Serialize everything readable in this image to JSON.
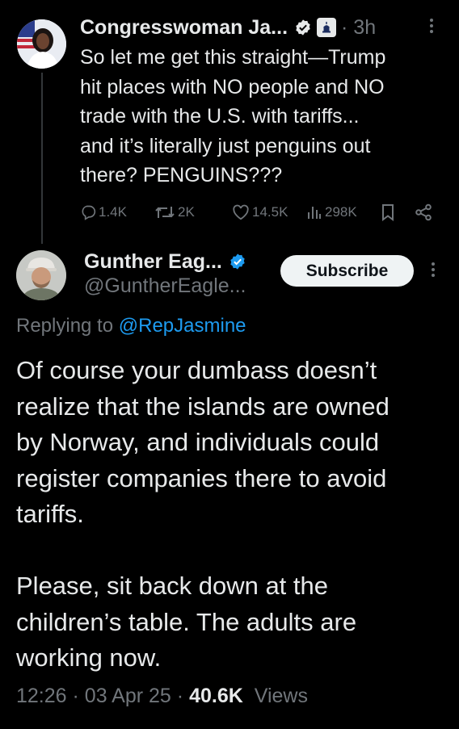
{
  "tweet1": {
    "name": "Congresswoman Ja...",
    "time": "· 3h",
    "text": "So let me get this straight—Trump\nhit places with NO people and NO\ntrade with the U.S. with tariffs...\nand it’s literally just penguins out\nthere? PENGUINS???",
    "actions": {
      "replies": "1.4K",
      "reposts": "2K",
      "likes": "14.5K",
      "views": "298K"
    }
  },
  "tweet2": {
    "name": "Gunther Eag...",
    "handle": "@GuntherEagle...",
    "subscribe_label": "Subscribe",
    "replying_prefix": "Replying to ",
    "replying_to": "@RepJasmine",
    "text": "Of course your dumbass doesn’t\nrealize that the islands are owned\nby Norway, and individuals could\nregister companies there to avoid\ntariffs.\n\nPlease, sit back down at the\nchildren’s table. The adults are\nworking now.",
    "time": "12:26",
    "date": "03 Apr 25",
    "views_count": "40.6K",
    "views_label": "Views"
  },
  "colors": {
    "background": "#000000",
    "text": "#e7e9ea",
    "muted": "#71767b",
    "link": "#1d9bf0"
  }
}
